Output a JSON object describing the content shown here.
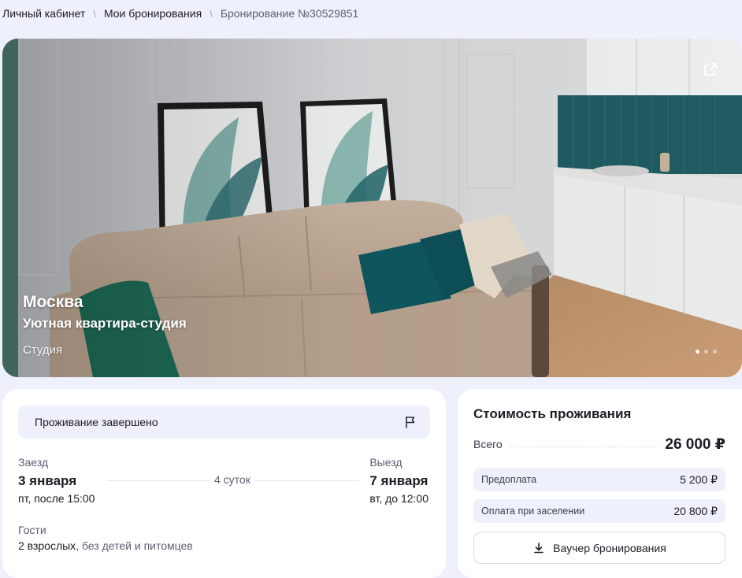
{
  "breadcrumb": {
    "items": [
      "Личный кабинет",
      "Мои бронирования",
      "Бронирование №30529851"
    ],
    "separator": "\\"
  },
  "listing": {
    "city": "Москва",
    "name": "Уютная квартира-студия",
    "type": "Студия",
    "gallery": {
      "slides": 3,
      "active": 1
    },
    "icons": {
      "open_external": "external-link-icon"
    }
  },
  "booking": {
    "status": "Проживание завершено",
    "status_icon": "flag-icon",
    "checkin": {
      "label": "Заезд",
      "date": "3 января",
      "detail": "пт, после 15:00"
    },
    "checkout": {
      "label": "Выезд",
      "date": "7 января",
      "detail": "вт, до 12:00"
    },
    "nights": "4 суток",
    "guests": {
      "label": "Гости",
      "adults": "2 взрослых",
      "others": ", без детей и питомцев"
    }
  },
  "price": {
    "title": "Стоимость проживания",
    "total_label": "Всего",
    "total_value": "26 000 ₽",
    "prepayment_label": "Предоплата",
    "prepayment_value": "5 200 ₽",
    "on_arrival_label": "Оплата при заселении",
    "on_arrival_value": "20 800 ₽",
    "voucher_button": "Ваучер бронирования",
    "voucher_icon": "download-icon"
  },
  "colors": {
    "page_bg": "#eef0fb",
    "card_bg": "#ffffff",
    "text_primary": "#1c1c24",
    "text_secondary": "#5c5f70"
  }
}
